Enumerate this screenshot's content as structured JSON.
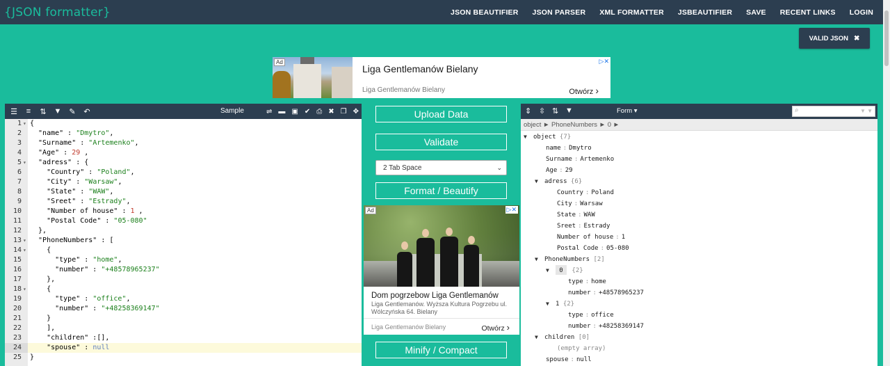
{
  "header": {
    "logo": "{JSON formatter}",
    "nav": [
      "JSON BEAUTIFIER",
      "JSON PARSER",
      "XML FORMATTER",
      "JSBEAUTIFIER",
      "SAVE",
      "RECENT LINKS",
      "LOGIN"
    ]
  },
  "status_badge": {
    "label": "VALID JSON",
    "close": "✖"
  },
  "ad_top": {
    "badge": "Ad",
    "title": "Liga Gentlemanów Bielany",
    "subtitle": "Liga Gentlemanów Bielany",
    "cta": "Otwórz",
    "cta_chevron": "›",
    "choice": "▷✕"
  },
  "left_toolbar": {
    "sample_label": "Sample"
  },
  "editor": {
    "active_line": 24,
    "lines": [
      {
        "n": "1",
        "fold": "▾",
        "code": "{"
      },
      {
        "n": "2",
        "fold": "",
        "code": "  \"name\" : \"Dmytro\","
      },
      {
        "n": "3",
        "fold": "",
        "code": "  \"Surname\" : \"Artemenko\","
      },
      {
        "n": "4",
        "fold": "",
        "code": "  \"Age\" : 29 ,"
      },
      {
        "n": "5",
        "fold": "▾",
        "code": "  \"adress\" : {"
      },
      {
        "n": "6",
        "fold": "",
        "code": "    \"Country\" : \"Poland\","
      },
      {
        "n": "7",
        "fold": "",
        "code": "    \"City\" : \"Warsaw\","
      },
      {
        "n": "8",
        "fold": "",
        "code": "    \"State\" : \"WAW\","
      },
      {
        "n": "9",
        "fold": "",
        "code": "    \"Sreet\" : \"Estrady\","
      },
      {
        "n": "10",
        "fold": "",
        "code": "    \"Number of house\" : 1 ,"
      },
      {
        "n": "11",
        "fold": "",
        "code": "    \"Postal Code\" : \"05-080\""
      },
      {
        "n": "12",
        "fold": "",
        "code": "  },"
      },
      {
        "n": "13",
        "fold": "▾",
        "code": "  \"PhoneNumbers\" : ["
      },
      {
        "n": "14",
        "fold": "▾",
        "code": "    {"
      },
      {
        "n": "15",
        "fold": "",
        "code": "      \"type\" : \"home\","
      },
      {
        "n": "16",
        "fold": "",
        "code": "      \"number\" : \"+48578965237\""
      },
      {
        "n": "17",
        "fold": "",
        "code": "    },"
      },
      {
        "n": "18",
        "fold": "▾",
        "code": "    {"
      },
      {
        "n": "19",
        "fold": "",
        "code": "      \"type\" : \"office\","
      },
      {
        "n": "20",
        "fold": "",
        "code": "      \"number\" : \"+48258369147\""
      },
      {
        "n": "21",
        "fold": "",
        "code": "    }"
      },
      {
        "n": "22",
        "fold": "",
        "code": "    ],"
      },
      {
        "n": "23",
        "fold": "",
        "code": "    \"children\" :[],"
      },
      {
        "n": "24",
        "fold": "",
        "code": "    \"spouse\" : null"
      },
      {
        "n": "25",
        "fold": "",
        "code": "}"
      }
    ]
  },
  "middle": {
    "upload": "Upload Data",
    "validate": "Validate",
    "indent_select": "2 Tab Space",
    "format": "Format / Beautify",
    "minify": "Minify / Compact"
  },
  "ad_mid": {
    "badge": "Ad",
    "title": "Dom pogrzebow Liga Gentlemanów",
    "body": "Liga Gentlemanów. Wyższa Kultura Pogrzebu ul. Wólczyńska 64. Bielany",
    "source": "Liga Gentlemanów Bielany",
    "cta": "Otwórz",
    "cta_chevron": "›",
    "choice": "▷✕"
  },
  "right_toolbar": {
    "mode": "Form ▾",
    "search_placeholder": ""
  },
  "breadcrumb": "object ► PhoneNumbers ► 0 ►",
  "tree": [
    {
      "indent": 0,
      "toggle": "▼",
      "key": "object",
      "meta": "{7}",
      "value": ""
    },
    {
      "indent": 2,
      "toggle": "",
      "key": "name",
      "meta": "",
      "value": "Dmytro"
    },
    {
      "indent": 2,
      "toggle": "",
      "key": "Surname",
      "meta": "",
      "value": "Artemenko"
    },
    {
      "indent": 2,
      "toggle": "",
      "key": "Age",
      "meta": "",
      "value": "29"
    },
    {
      "indent": 1,
      "toggle": "▼",
      "key": "adress",
      "meta": "{6}",
      "value": ""
    },
    {
      "indent": 3,
      "toggle": "",
      "key": "Country",
      "meta": "",
      "value": "Poland"
    },
    {
      "indent": 3,
      "toggle": "",
      "key": "City",
      "meta": "",
      "value": "Warsaw"
    },
    {
      "indent": 3,
      "toggle": "",
      "key": "State",
      "meta": "",
      "value": "WAW"
    },
    {
      "indent": 3,
      "toggle": "",
      "key": "Sreet",
      "meta": "",
      "value": "Estrady"
    },
    {
      "indent": 3,
      "toggle": "",
      "key": "Number of house",
      "meta": "",
      "value": "1"
    },
    {
      "indent": 3,
      "toggle": "",
      "key": "Postal Code",
      "meta": "",
      "value": "05-080"
    },
    {
      "indent": 1,
      "toggle": "▼",
      "key": "PhoneNumbers",
      "meta": "[2]",
      "value": ""
    },
    {
      "indent": 2,
      "toggle": "▼",
      "key": "0",
      "meta": "{2}",
      "value": "",
      "selected": true
    },
    {
      "indent": 4,
      "toggle": "",
      "key": "type",
      "meta": "",
      "value": "home"
    },
    {
      "indent": 4,
      "toggle": "",
      "key": "number",
      "meta": "",
      "value": "+48578965237"
    },
    {
      "indent": 2,
      "toggle": "▼",
      "key": "1",
      "meta": "{2}",
      "value": ""
    },
    {
      "indent": 4,
      "toggle": "",
      "key": "type",
      "meta": "",
      "value": "office"
    },
    {
      "indent": 4,
      "toggle": "",
      "key": "number",
      "meta": "",
      "value": "+48258369147"
    },
    {
      "indent": 1,
      "toggle": "▼",
      "key": "children",
      "meta": "[0]",
      "value": ""
    },
    {
      "indent": 3,
      "toggle": "",
      "key": "",
      "meta": "(empty array)",
      "value": ""
    },
    {
      "indent": 2,
      "toggle": "",
      "key": "spouse",
      "meta": "",
      "value": "null"
    }
  ],
  "colors": {
    "accent": "#1abc9c",
    "dark": "#2c3e50"
  }
}
